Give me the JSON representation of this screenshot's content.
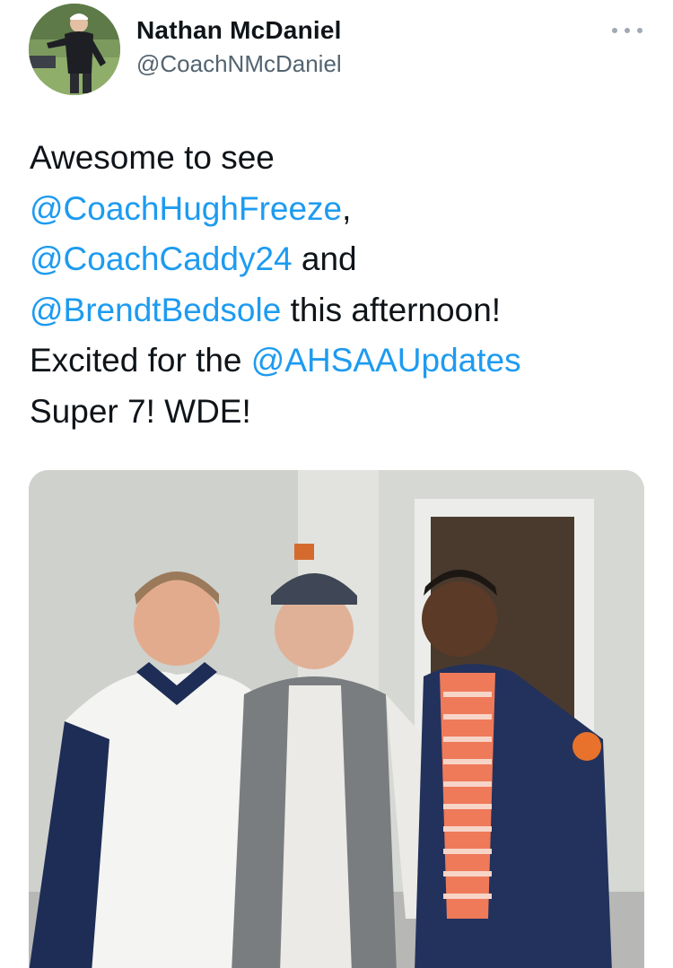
{
  "user": {
    "display_name": "Nathan McDaniel",
    "handle": "@CoachNMcDaniel"
  },
  "tweet": {
    "lines": [
      [
        {
          "text": "Awesome to see",
          "mention": false
        }
      ],
      [
        {
          "text": "@CoachHughFreeze",
          "mention": true
        },
        {
          "text": ",",
          "mention": false
        }
      ],
      [
        {
          "text": "@CoachCaddy24",
          "mention": true
        },
        {
          "text": " and",
          "mention": false
        }
      ],
      [
        {
          "text": "@BrendtBedsole",
          "mention": true
        },
        {
          "text": " this afternoon!",
          "mention": false
        }
      ],
      [
        {
          "text": "Excited for the ",
          "mention": false
        },
        {
          "text": "@AHSAAUpdates",
          "mention": true
        }
      ],
      [
        {
          "text": "Super 7! WDE!",
          "mention": false
        }
      ]
    ]
  },
  "icons": {
    "more": "more-horizontal-icon"
  },
  "colors": {
    "mention": "#1d9bf0",
    "text": "#0f1419",
    "handle": "#536471"
  }
}
